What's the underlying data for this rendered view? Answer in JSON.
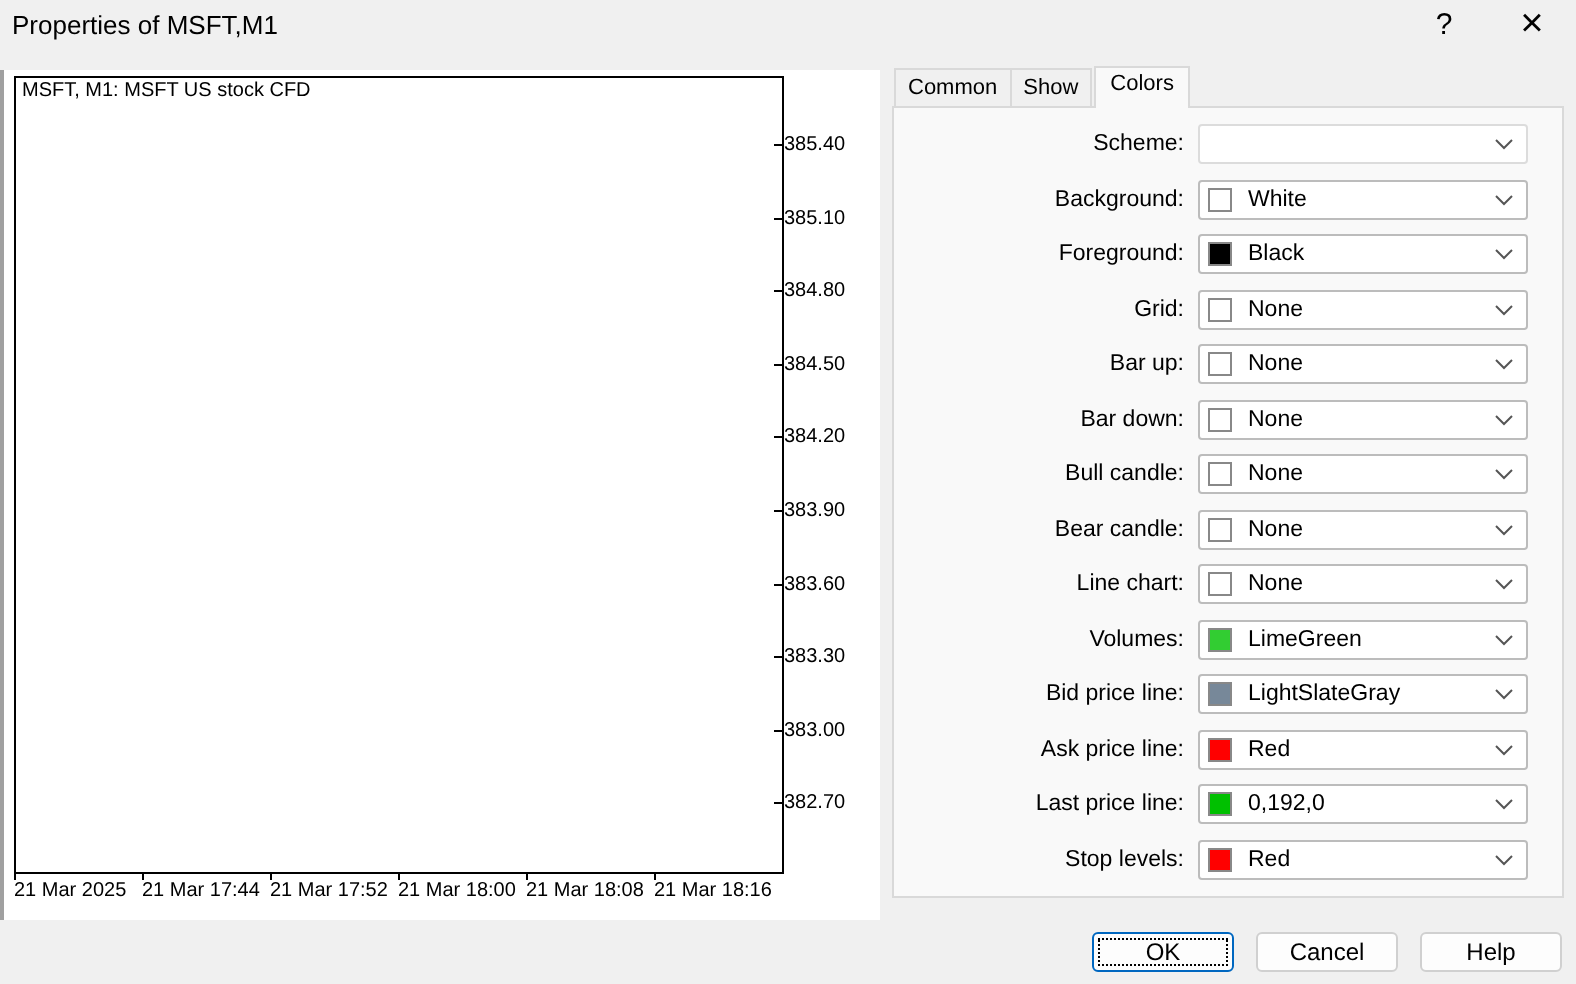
{
  "window": {
    "title": "Properties of MSFT,M1",
    "help": "?",
    "close": "×"
  },
  "chart": {
    "title": "MSFT, M1:  MSFT US stock CFD",
    "price_labels": [
      "385.40",
      "385.10",
      "384.80",
      "384.50",
      "384.20",
      "383.90",
      "383.60",
      "383.30",
      "383.00",
      "382.70"
    ],
    "time_labels": [
      "21 Mar 2025",
      "21 Mar 17:44",
      "21 Mar 17:52",
      "21 Mar 18:00",
      "21 Mar 18:08",
      "21 Mar 18:16"
    ]
  },
  "tabs": [
    {
      "label": "Common",
      "selected": false
    },
    {
      "label": "Show",
      "selected": false
    },
    {
      "label": "Colors",
      "selected": true
    }
  ],
  "rows": [
    {
      "label": "Scheme:"
    },
    {
      "label": "Background:",
      "value": "White",
      "color": "#ffffff"
    },
    {
      "label": "Foreground:",
      "value": "Black",
      "color": "#000000"
    },
    {
      "label": "Grid:",
      "value": "None",
      "color": "#ffffff"
    },
    {
      "label": "Bar up:",
      "value": "None",
      "color": "#ffffff"
    },
    {
      "label": "Bar down:",
      "value": "None",
      "color": "#ffffff"
    },
    {
      "label": "Bull candle:",
      "value": "None",
      "color": "#ffffff"
    },
    {
      "label": "Bear candle:",
      "value": "None",
      "color": "#ffffff"
    },
    {
      "label": "Line chart:",
      "value": "None",
      "color": "#ffffff"
    },
    {
      "label": "Volumes:",
      "value": "LimeGreen",
      "color": "#32cd32"
    },
    {
      "label": "Bid price line:",
      "value": "LightSlateGray",
      "color": "#778899"
    },
    {
      "label": "Ask price line:",
      "value": "Red",
      "color": "#ff0000"
    },
    {
      "label": "Last price line:",
      "value": "0,192,0",
      "color": "#00c000"
    },
    {
      "label": "Stop levels:",
      "value": "Red",
      "color": "#ff0000"
    }
  ],
  "buttons": [
    {
      "label": "OK",
      "selected": true
    },
    {
      "label": "Cancel",
      "selected": false
    },
    {
      "label": "Help",
      "selected": false
    }
  ]
}
